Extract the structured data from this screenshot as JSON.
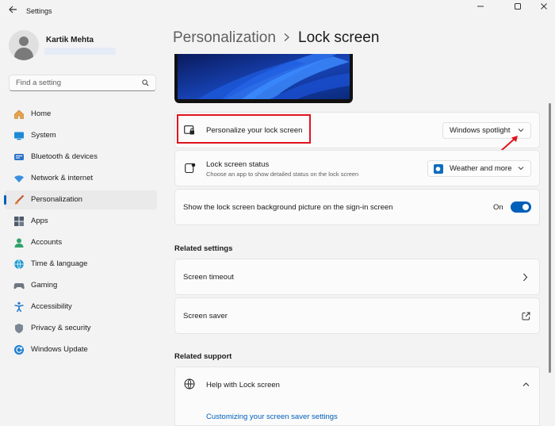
{
  "window": {
    "title": "Settings",
    "back_icon": "back-arrow-icon",
    "controls": [
      "minimize-icon",
      "maximize-icon",
      "close-icon"
    ]
  },
  "user": {
    "name": "Kartik Mehta"
  },
  "search": {
    "placeholder": "Find a setting"
  },
  "nav": {
    "items": [
      {
        "label": "Home",
        "icon": "home-icon"
      },
      {
        "label": "System",
        "icon": "system-icon"
      },
      {
        "label": "Bluetooth & devices",
        "icon": "bluetooth-icon"
      },
      {
        "label": "Network & internet",
        "icon": "network-icon"
      },
      {
        "label": "Personalization",
        "icon": "brush-icon",
        "active": true
      },
      {
        "label": "Apps",
        "icon": "apps-icon"
      },
      {
        "label": "Accounts",
        "icon": "accounts-icon"
      },
      {
        "label": "Time & language",
        "icon": "time-language-icon"
      },
      {
        "label": "Gaming",
        "icon": "gaming-icon"
      },
      {
        "label": "Accessibility",
        "icon": "accessibility-icon"
      },
      {
        "label": "Privacy & security",
        "icon": "shield-icon"
      },
      {
        "label": "Windows Update",
        "icon": "windows-update-icon"
      }
    ]
  },
  "header": {
    "parent": "Personalization",
    "current": "Lock screen"
  },
  "settings": {
    "personalize": {
      "label": "Personalize your lock screen",
      "value": "Windows spotlight"
    },
    "status": {
      "label": "Lock screen status",
      "description": "Choose an app to show detailed status on the lock screen",
      "value": "Weather and more"
    },
    "signin_bg": {
      "label": "Show the lock screen background picture on the sign-in screen",
      "state": "On"
    }
  },
  "related_settings": {
    "heading": "Related settings",
    "items": [
      {
        "label": "Screen timeout",
        "icon": "chevron-right-icon"
      },
      {
        "label": "Screen saver",
        "icon": "external-link-icon"
      }
    ]
  },
  "related_support": {
    "heading": "Related support",
    "help": "Help with Lock screen",
    "link": "Customizing your screen saver settings"
  },
  "colors": {
    "accent": "#005fb8",
    "highlight": "#e0141e",
    "background": "#f3f3f3",
    "card": "#fbfbfb"
  }
}
